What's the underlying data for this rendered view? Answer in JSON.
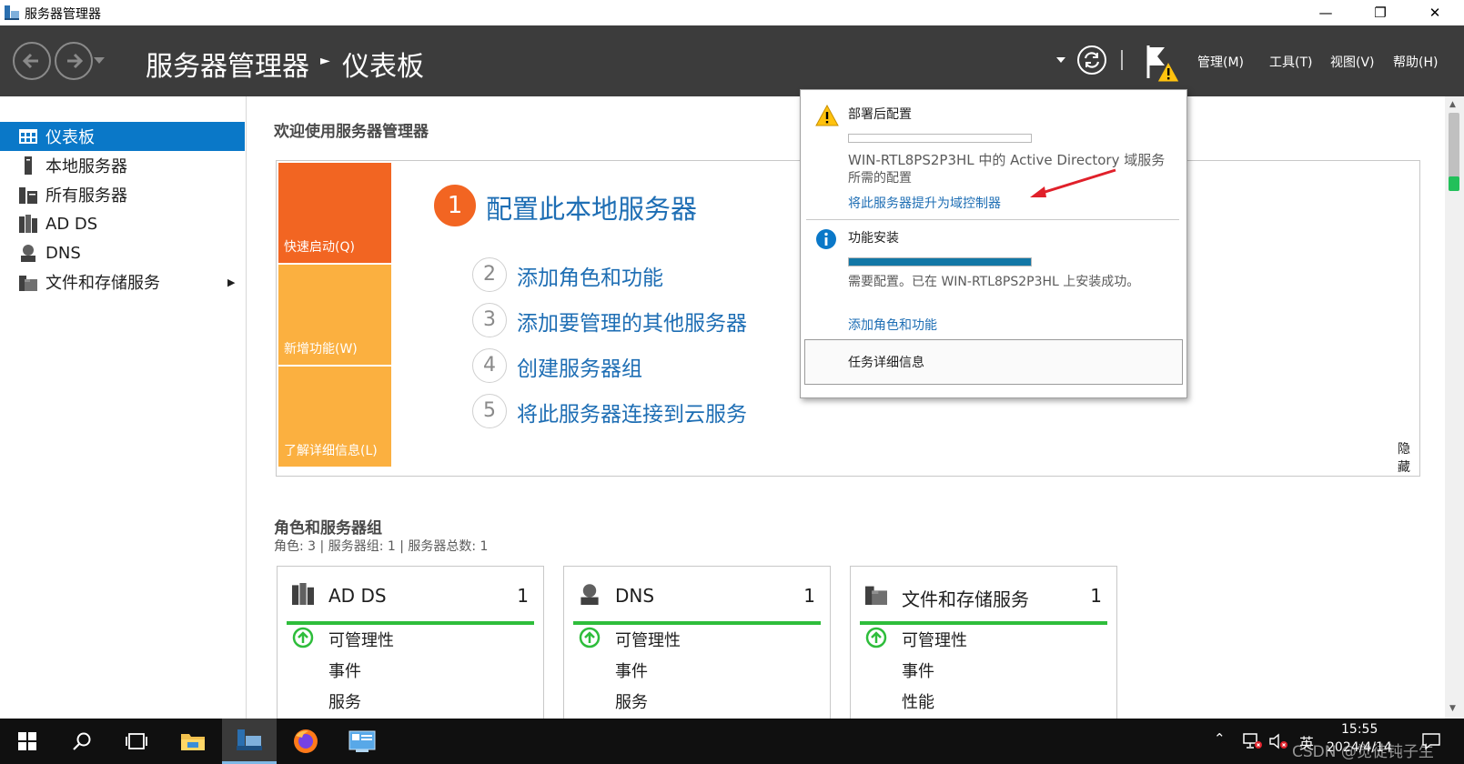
{
  "window": {
    "title": "服务器管理器",
    "minimize_glyph": "—",
    "restore_glyph": "❐",
    "close_glyph": "✕"
  },
  "header": {
    "app": "服务器管理器",
    "page": "仪表板",
    "menus": [
      {
        "label": "管理(M)"
      },
      {
        "label": "工具(T)"
      },
      {
        "label": "视图(V)"
      },
      {
        "label": "帮助(H)"
      }
    ]
  },
  "sidebar": {
    "items": [
      {
        "label": "仪表板",
        "icon": "dashboard-icon"
      },
      {
        "label": "本地服务器",
        "icon": "server-icon"
      },
      {
        "label": "所有服务器",
        "icon": "servers-icon"
      },
      {
        "label": "AD DS",
        "icon": "ad-ds-icon"
      },
      {
        "label": "DNS",
        "icon": "dns-icon"
      },
      {
        "label": "文件和存储服务",
        "icon": "file-storage-icon"
      }
    ]
  },
  "welcome": {
    "title": "欢迎使用服务器管理器",
    "tiles": [
      "快速启动(Q)",
      "新增功能(W)",
      "了解详细信息(L)"
    ],
    "steps": [
      {
        "num": "1",
        "label": "配置此本地服务器"
      },
      {
        "num": "2",
        "label": "添加角色和功能"
      },
      {
        "num": "3",
        "label": "添加要管理的其他服务器"
      },
      {
        "num": "4",
        "label": "创建服务器组"
      },
      {
        "num": "5",
        "label": "将此服务器连接到云服务"
      }
    ],
    "hide": "隐藏"
  },
  "roles": {
    "title": "角色和服务器组",
    "summary": "角色: 3 | 服务器组: 1 | 服务器总数: 1",
    "cards": [
      {
        "name": "AD DS",
        "count": "1",
        "rows": [
          "可管理性",
          "事件",
          "服务"
        ]
      },
      {
        "name": "DNS",
        "count": "1",
        "rows": [
          "可管理性",
          "事件",
          "服务"
        ]
      },
      {
        "name": "文件和存储服务",
        "count": "1",
        "rows": [
          "可管理性",
          "事件",
          "性能"
        ]
      }
    ]
  },
  "popup": {
    "deploy_title": "部署后配置",
    "deploy_desc_1": "WIN-RTL8PS2P3HL 中的 Active Directory 域服务",
    "deploy_desc_2": "所需的配置",
    "deploy_link": "将此服务器提升为域控制器",
    "feature_title": "功能安装",
    "feature_progress": 1.0,
    "feature_desc": "需要配置。已在 WIN-RTL8PS2P3HL 上安装成功。",
    "feature_link": "添加角色和功能",
    "task_details": "任务详细信息"
  },
  "taskbar": {
    "ime": "英",
    "time": "15:55",
    "date": "2024/4/14",
    "watermark": "CSDN @觉徒钝子生"
  },
  "colors": {
    "header_bg": "#3c3c3c",
    "accent_blue": "#0a78c8",
    "quickstart_orange": "#f26522",
    "tile_orange": "#fbb040",
    "health_green": "#2ebd3b",
    "link_blue": "#1e6eb4",
    "warning_yellow": "#ffc20e"
  }
}
